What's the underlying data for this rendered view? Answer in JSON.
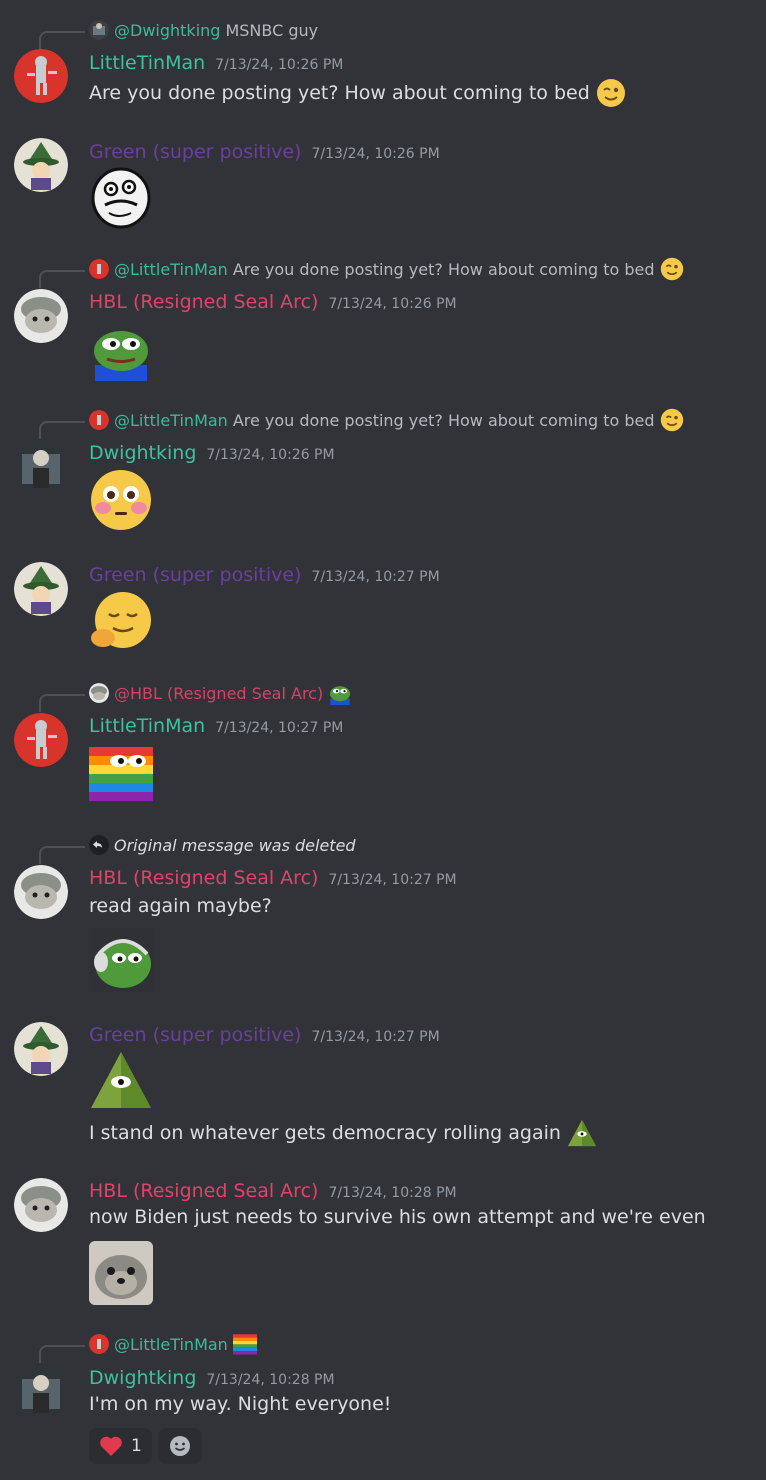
{
  "users": {
    "littletinman": {
      "name": "LittleTinMan",
      "color": "#3fc1a0"
    },
    "green": {
      "name": "Green (super positive)",
      "color": "#6a3f9e"
    },
    "hbl": {
      "name": "HBL (Resigned Seal Arc)",
      "color": "#e0436a"
    },
    "dwightking": {
      "name": "Dwightking",
      "color": "#3fc1a0"
    }
  },
  "messages": [
    {
      "reply_mention": "@Dwightking",
      "reply_text": "MSNBC guy",
      "author": "LittleTinMan",
      "timestamp": "7/13/24, 10:26 PM",
      "text": "Are you done posting yet? How about coming to bed",
      "emoji": "wink-emoji"
    },
    {
      "author": "Green (super positive)",
      "timestamp": "7/13/24, 10:26 PM",
      "emoji": "rage-face-emoji"
    },
    {
      "reply_mention": "@LittleTinMan",
      "reply_text": "Are you done posting yet? How about coming to bed",
      "author": "HBL (Resigned Seal Arc)",
      "timestamp": "7/13/24, 10:26 PM",
      "emoji": "pepe-emoji"
    },
    {
      "reply_mention": "@LittleTinMan",
      "reply_text": "Are you done posting yet? How about coming to bed",
      "author": "Dwightking",
      "timestamp": "7/13/24, 10:26 PM",
      "emoji": "flushed-emoji"
    },
    {
      "author": "Green (super positive)",
      "timestamp": "7/13/24, 10:27 PM",
      "emoji": "smug-emoji"
    },
    {
      "reply_mention": "@HBL (Resigned Seal Arc)",
      "author": "LittleTinMan",
      "timestamp": "7/13/24, 10:27 PM",
      "emoji": "rainbow-pepe-emoji"
    },
    {
      "reply_deleted": "Original message was deleted",
      "author": "HBL (Resigned Seal Arc)",
      "timestamp": "7/13/24, 10:27 PM",
      "text": "read again maybe?",
      "emoji": "pepe-headphones-emoji"
    },
    {
      "author": "Green (super positive)",
      "timestamp": "7/13/24, 10:27 PM",
      "emoji": "pepe-pyramid-emoji",
      "text": "I stand on whatever gets democracy rolling again"
    },
    {
      "author": "HBL (Resigned Seal Arc)",
      "timestamp": "7/13/24, 10:28 PM",
      "text": "now Biden just needs to survive his own attempt and we're even",
      "emoji": "seal-emoji"
    },
    {
      "reply_mention": "@LittleTinMan",
      "author": "Dwightking",
      "timestamp": "7/13/24, 10:28 PM",
      "text": "I'm on my way. Night everyone!",
      "reactions": [
        {
          "emoji": "heart-emoji",
          "count": "1"
        }
      ]
    }
  ]
}
